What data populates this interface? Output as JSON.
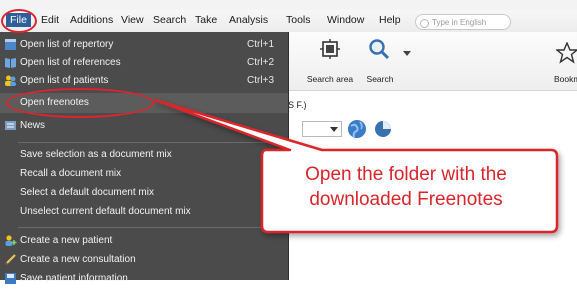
{
  "menubar": {
    "items": [
      "File",
      "Edit",
      "Additions",
      "View",
      "Search",
      "Take",
      "Analysis",
      "Tools",
      "Window",
      "Help"
    ]
  },
  "file_menu": {
    "items": [
      {
        "label": "Open list of repertory",
        "shortcut": "Ctrl+1",
        "icon": "repertory-icon"
      },
      {
        "label": "Open list of references",
        "shortcut": "Ctrl+2",
        "icon": "book-icon"
      },
      {
        "label": "Open list of patients",
        "shortcut": "Ctrl+3",
        "icon": "patients-icon"
      },
      {
        "label": "Open freenotes",
        "shortcut": "",
        "icon": ""
      },
      {
        "label": "News",
        "shortcut": "",
        "icon": "news-icon"
      },
      {
        "label": "Save selection as a document mix",
        "shortcut": "",
        "icon": ""
      },
      {
        "label": "Recall a document mix",
        "shortcut": "",
        "icon": ""
      },
      {
        "label": "Select a default document mix",
        "shortcut": "",
        "icon": ""
      },
      {
        "label": "Unselect current default document mix",
        "shortcut": "",
        "icon": ""
      },
      {
        "label": "Create a new patient",
        "shortcut": "",
        "icon": "new-patient-icon"
      },
      {
        "label": "Create a new consultation",
        "shortcut": "",
        "icon": "consultation-icon"
      },
      {
        "label": "Save patient information",
        "shortcut": "",
        "icon": "save-icon"
      }
    ]
  },
  "toolbar": {
    "search_area_label": "Search area",
    "search_label": "Search",
    "search_placeholder": "Type in English",
    "bookmark_label": "Bookmar"
  },
  "background": {
    "partial_label": "S F.)"
  },
  "callout": {
    "line1": "Open the folder with the",
    "line2": "downloaded Freenotes"
  },
  "colors": {
    "annotation_red": "#d9262c",
    "menu_bg": "#4b4b4b",
    "menubar_active": "#2f5f9a"
  }
}
